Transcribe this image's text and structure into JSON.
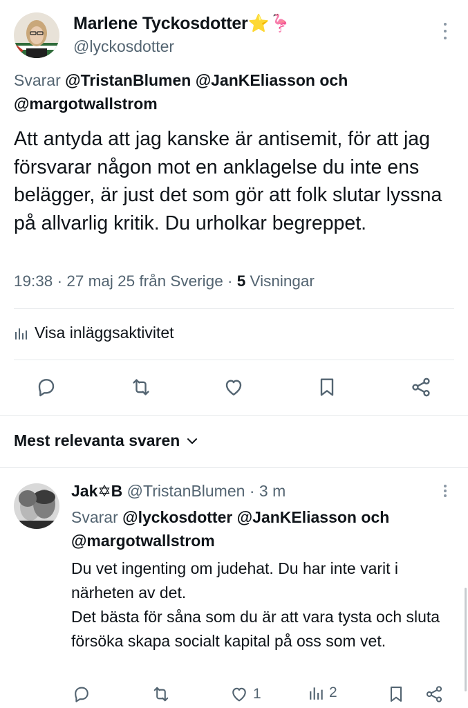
{
  "tweet": {
    "author_name": "Marlene Tyckosdotter",
    "author_emoji": "⭐🦩",
    "handle": "@lyckosdotter",
    "reply_prefix": "Svarar",
    "reply_mentions": "@TristanBlumen @JanKEliasson",
    "reply_and": "och",
    "reply_mention_last": "@margotwallstrom",
    "body": "Att antyda att jag kanske är antisemit, för att jag försvarar någon mot en anklagelse du inte ens belägger, är just det som gör att folk slutar lyssna på allvarlig kritik. Du urholkar begreppet.",
    "time": "19:38",
    "date": "27 maj 25",
    "location": "från Sverige",
    "views_count": "5",
    "views_label": "Visningar",
    "activity_label": "Visa inläggsaktivitet",
    "actions": [
      "reply",
      "retweet",
      "like",
      "bookmark",
      "share"
    ]
  },
  "replies_section": {
    "title": "Mest relevanta svaren"
  },
  "reply": {
    "author_name": "Jak✡B",
    "handle": "@TristanBlumen",
    "time": "3 m",
    "reply_prefix": "Svarar",
    "reply_mentions": "@lyckosdotter @JanKEliasson",
    "reply_and": "och",
    "reply_mention_last": "@margotwallstrom",
    "body_line1": "Du vet ingenting om judehat. Du har inte varit i närheten av det.",
    "body_line2": "Det bästa för såna som du är att vara tysta och sluta försöka skapa socialt kapital på oss som vet.",
    "like_count": "1",
    "views_count": "2"
  },
  "colors": {
    "text_primary": "#0f1419",
    "text_secondary": "#536471",
    "divider": "#e6e9eb"
  }
}
